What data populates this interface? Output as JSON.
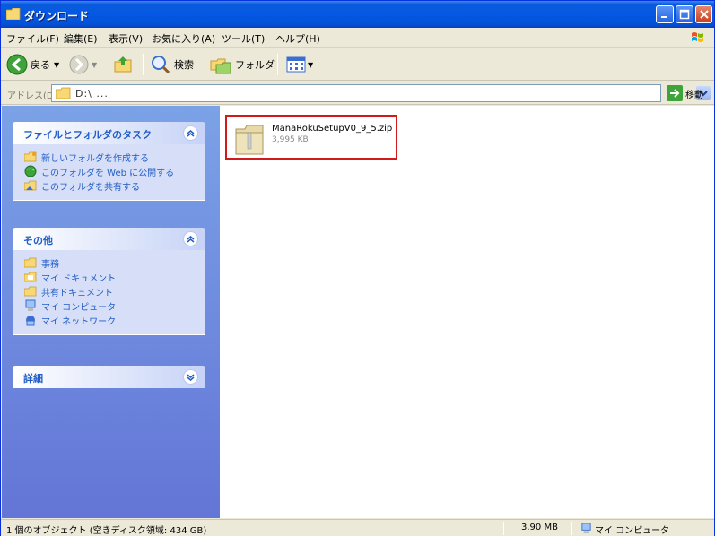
{
  "window": {
    "title": "ダウンロード",
    "accent": "#0558e4"
  },
  "menu": {
    "items": [
      "ファイル(F)",
      "編集(E)",
      "表示(V)",
      "お気に入り(A)",
      "ツール(T)",
      "ヘルプ(H)"
    ]
  },
  "toolbar": {
    "back_label": "戻る",
    "search_label": "検索",
    "folders_label": "フォルダ"
  },
  "address": {
    "label": "アドレス(D)",
    "value": "D:\\ ...",
    "go_label": "移動"
  },
  "tasks": {
    "file_folder_title": "ファイルとフォルダのタスク",
    "file_folder_items": [
      "新しいフォルダを作成する",
      "このフォルダを Web に公開する",
      "このフォルダを共有する"
    ],
    "other_title": "その他",
    "other_items": [
      "事務",
      "マイ ドキュメント",
      "共有ドキュメント",
      "マイ コンピュータ",
      "マイ ネットワーク"
    ],
    "details_title": "詳細"
  },
  "file": {
    "name": "ManaRokuSetupV0_9_5.zip",
    "size": "3,995 KB"
  },
  "status": {
    "left": "1 個のオブジェクト (空きディスク領域: 434 GB)",
    "size": "3.90 MB",
    "location": "マイ コンピュータ"
  }
}
